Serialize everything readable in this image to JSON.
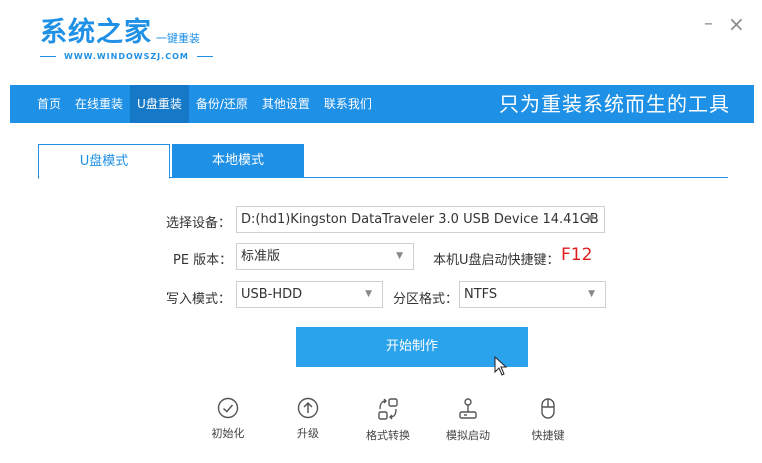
{
  "app": {
    "logo_title": "系统之家",
    "logo_tag": "一键重装",
    "logo_url": "WWW.WINDOWSZJ.COM",
    "minimize": "–",
    "close": "×"
  },
  "nav": {
    "items": [
      {
        "label": "首页"
      },
      {
        "label": "在线重装"
      },
      {
        "label": "U盘重装"
      },
      {
        "label": "备份/还原"
      },
      {
        "label": "其他设置"
      },
      {
        "label": "联系我们"
      }
    ],
    "active": "U盘重装",
    "slogan": "只为重装系统而生的工具"
  },
  "tabs": {
    "u_mode": "U盘模式",
    "local_mode": "本地模式"
  },
  "form": {
    "device_label": "选择设备：",
    "device_value": "D:(hd1)Kingston DataTraveler 3.0 USB Device 14.41GB",
    "pe_label": "PE 版本：",
    "pe_value": "标准版",
    "hotkey_label": "本机U盘启动快捷键：",
    "hotkey_value": "F12",
    "write_label": "写入模式：",
    "write_value": "USB-HDD",
    "partition_label": "分区格式：",
    "partition_value": "NTFS",
    "dropdown_arrow": "▼"
  },
  "start_button": "开始制作",
  "tools": [
    {
      "label": "初始化",
      "icon": "check-circle-icon"
    },
    {
      "label": "升级",
      "icon": "arrow-up-circle-icon"
    },
    {
      "label": "格式转换",
      "icon": "convert-icon"
    },
    {
      "label": "模拟启动",
      "icon": "joystick-icon"
    },
    {
      "label": "快捷键",
      "icon": "mouse-icon"
    }
  ],
  "colors": {
    "brand_blue": "#1e90e6",
    "active_nav": "#1679c8",
    "button_blue": "#2aa3ec",
    "hotkey_red": "#e02020"
  }
}
